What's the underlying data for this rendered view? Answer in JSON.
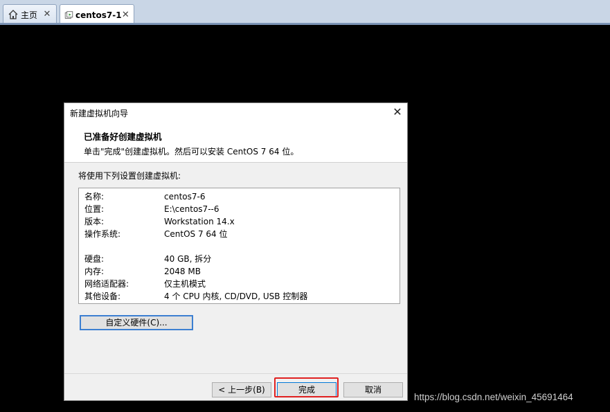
{
  "tabs": [
    {
      "label": "主页",
      "icon": "home-icon"
    },
    {
      "label": "centos7-1",
      "icon": "vm-icon"
    }
  ],
  "dialog": {
    "title": "新建虚拟机向导",
    "header_title": "已准备好创建虚拟机",
    "header_subtitle": "单击\"完成\"创建虚拟机。然后可以安装 CentOS 7 64 位。",
    "prompt": "将使用下列设置创建虚拟机:",
    "summary": [
      {
        "key": "名称:",
        "value": "centos7-6"
      },
      {
        "key": "位置:",
        "value": "E:\\centos7--6"
      },
      {
        "key": "版本:",
        "value": "Workstation 14.x"
      },
      {
        "key": "操作系统:",
        "value": "CentOS 7 64 位"
      },
      {
        "key": "硬盘:",
        "value": "40 GB, 拆分"
      },
      {
        "key": "内存:",
        "value": "2048 MB"
      },
      {
        "key": "网络适配器:",
        "value": "仅主机模式"
      },
      {
        "key": "其他设备:",
        "value": "4 个 CPU 内核, CD/DVD, USB 控制器"
      }
    ],
    "customize_label": "自定义硬件(C)...",
    "back_label": "< 上一步(B)",
    "finish_label": "完成",
    "cancel_label": "取消"
  },
  "watermark": "https://blog.csdn.net/weixin_45691464",
  "colors": {
    "highlight": "#e02020",
    "focus": "#3c7fd1"
  }
}
